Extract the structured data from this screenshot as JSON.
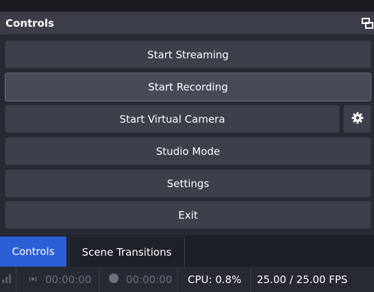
{
  "dock": {
    "title": "Controls",
    "icons": {
      "undock": "undock-icon",
      "gear": "gear-icon"
    }
  },
  "controls": {
    "start_streaming": "Start Streaming",
    "start_recording": "Start Recording",
    "start_virtual_camera": "Start Virtual Camera",
    "studio_mode": "Studio Mode",
    "settings": "Settings",
    "exit": "Exit"
  },
  "tabs": [
    {
      "label": "Controls",
      "active": true
    },
    {
      "label": "Scene Transitions",
      "active": false
    }
  ],
  "status": {
    "stream_time": "00:00:00",
    "record_time": "00:00:00",
    "cpu": "CPU: 0.8%",
    "fps": "25.00 / 25.00 FPS",
    "icons": {
      "signal": "signal-bars-icon",
      "stream": "stream-indicator-icon",
      "record": "record-dot-icon"
    }
  },
  "colors": {
    "accent": "#2b5fd6",
    "button": "#3c404b",
    "dock_bg": "#272a33",
    "title_bar": "#3b3e48"
  }
}
